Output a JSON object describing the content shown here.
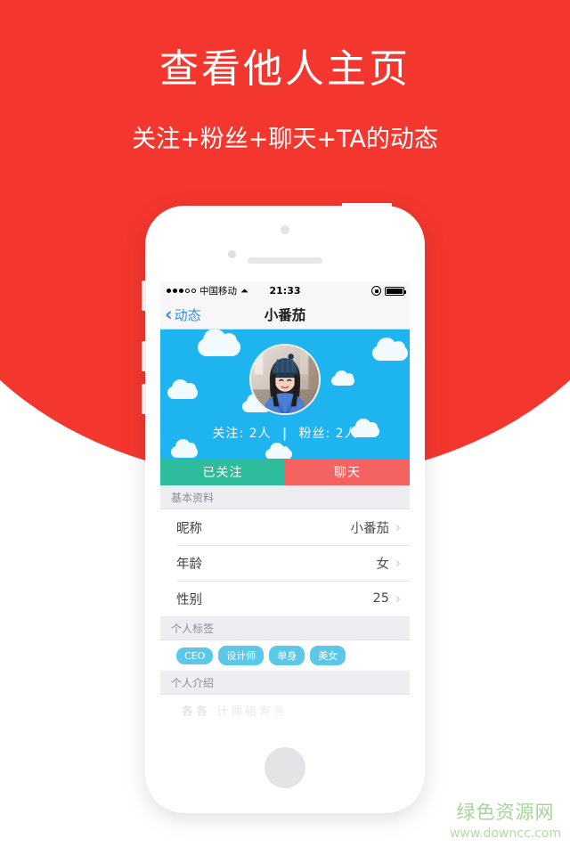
{
  "promo": {
    "headline": "查看他人主页",
    "subheadline": "关注+粉丝+聊天+TA的动态",
    "bg_color": "#f4372e"
  },
  "phone": {
    "status_bar": {
      "carrier": "中国移动",
      "wifi_icon": "wifi-icon",
      "time": "21:33",
      "signal_dots_filled": 3,
      "signal_dots_total": 5,
      "rotation_lock_icon": "rotation-lock-icon",
      "battery_icon": "battery-full-icon"
    },
    "nav_bar": {
      "back_icon": "chevron-left-icon",
      "back_label": "动态",
      "title": "小番茄"
    },
    "banner": {
      "bg_color": "#1eb4f0",
      "avatar_name": "avatar",
      "following_label": "关注: 2人",
      "divider": "|",
      "followers_label": "粉丝: 2人"
    },
    "actions": {
      "follow_label": "已关注",
      "follow_color": "#2dbd9c",
      "chat_label": "聊天",
      "chat_color": "#f4635f"
    },
    "sections": [
      {
        "title": "基本资料",
        "rows": [
          {
            "label": "昵称",
            "value": "小番茄"
          },
          {
            "label": "年龄",
            "value": "女"
          },
          {
            "label": "性别",
            "value": "25"
          }
        ]
      },
      {
        "title": "个人标签",
        "tags": [
          "CEO",
          "设计师",
          "单身",
          "美女"
        ],
        "tag_color": "#5bc8e8"
      },
      {
        "title": "个人介绍",
        "intro": "各各 计师硌寿身"
      }
    ]
  },
  "watermark": {
    "cn": "绿色资源网",
    "url": "www.downcc.com",
    "color": "#a4d796"
  }
}
